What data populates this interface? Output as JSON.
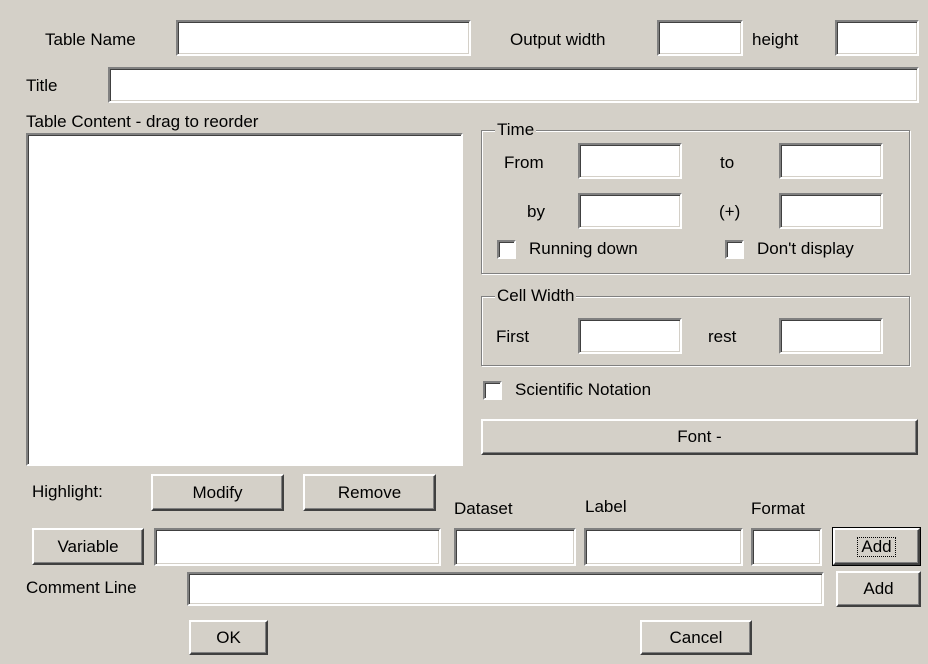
{
  "header": {
    "table_name_label": "Table Name",
    "table_name_value": "",
    "output_width_label": "Output width",
    "output_width_value": "",
    "height_label": "height",
    "height_value": "",
    "title_label": "Title",
    "title_value": ""
  },
  "content": {
    "label": "Table Content - drag to reorder",
    "items": []
  },
  "time": {
    "group_label": "Time",
    "from_label": "From",
    "from_value": "",
    "to_label": "to",
    "to_value": "",
    "by_label": "by",
    "by_value": "",
    "plus_label": "(+)",
    "plus_value": "",
    "running_down_label": "Running down",
    "dont_display_label": "Don't display"
  },
  "cell_width": {
    "group_label": "Cell Width",
    "first_label": "First",
    "first_value": "",
    "rest_label": "rest",
    "rest_value": ""
  },
  "scientific_label": "Scientific Notation",
  "font_button": "Font -",
  "highlight": {
    "label": "Highlight:",
    "modify_button": "Modify",
    "remove_button": "Remove"
  },
  "variable_row": {
    "dataset_label": "Dataset",
    "label_label": "Label",
    "format_label": "Format",
    "variable_button": "Variable",
    "variable_value": "",
    "dataset_value": "",
    "label_value": "",
    "format_value": "",
    "add_button": "Add"
  },
  "comment_row": {
    "label": "Comment Line",
    "value": "",
    "add_button": "Add"
  },
  "footer": {
    "ok_button": "OK",
    "cancel_button": "Cancel"
  }
}
